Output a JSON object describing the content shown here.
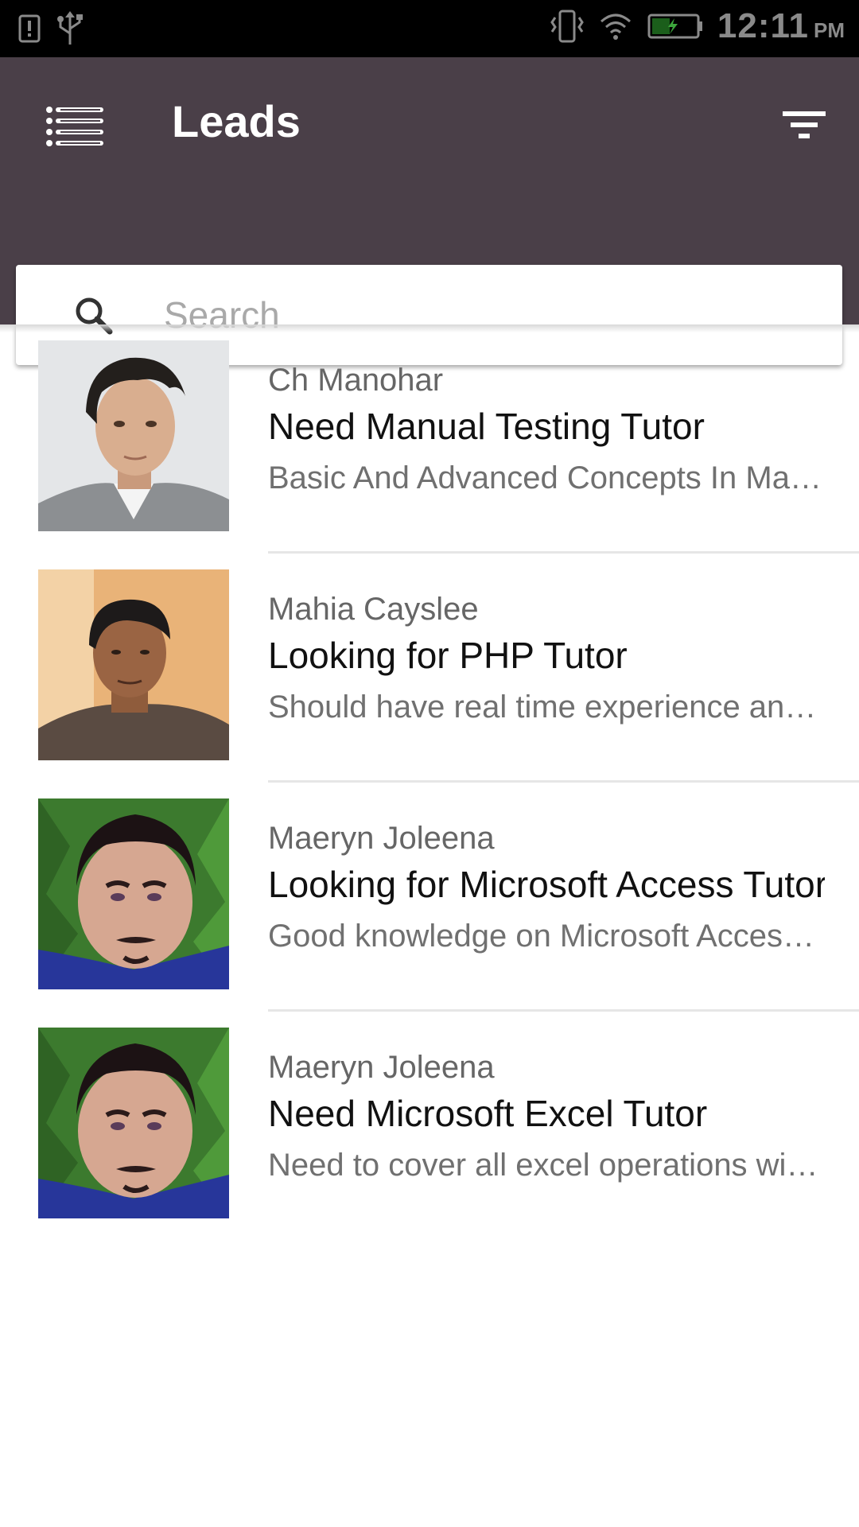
{
  "status_bar": {
    "time": "12:11",
    "ampm": "PM",
    "icons": [
      "alert-icon",
      "usb-icon",
      "vibrate-icon",
      "wifi-icon",
      "battery-icon"
    ]
  },
  "app_bar": {
    "title": "Leads",
    "menu_icon": "list-menu-icon",
    "filter_icon": "filter-icon",
    "background_color": "#4a3f48"
  },
  "search": {
    "placeholder": "Search",
    "value": ""
  },
  "leads": [
    {
      "name": "Ch Manohar",
      "title": "Need Manual Testing Tutor",
      "description": "Basic And Advanced Concepts In Manual Testing"
    },
    {
      "name": "Mahia Cayslee",
      "title": "Looking for PHP Tutor",
      "description": "Should have real time experience and knowledge"
    },
    {
      "name": "Maeryn Joleena",
      "title": "Looking for Microsoft Access Tutor",
      "description": "Good knowledge on Microsoft Access required"
    },
    {
      "name": "Maeryn Joleena",
      "title": "Need Microsoft Excel Tutor",
      "description": "Need to cover all excel operations with examples"
    }
  ]
}
